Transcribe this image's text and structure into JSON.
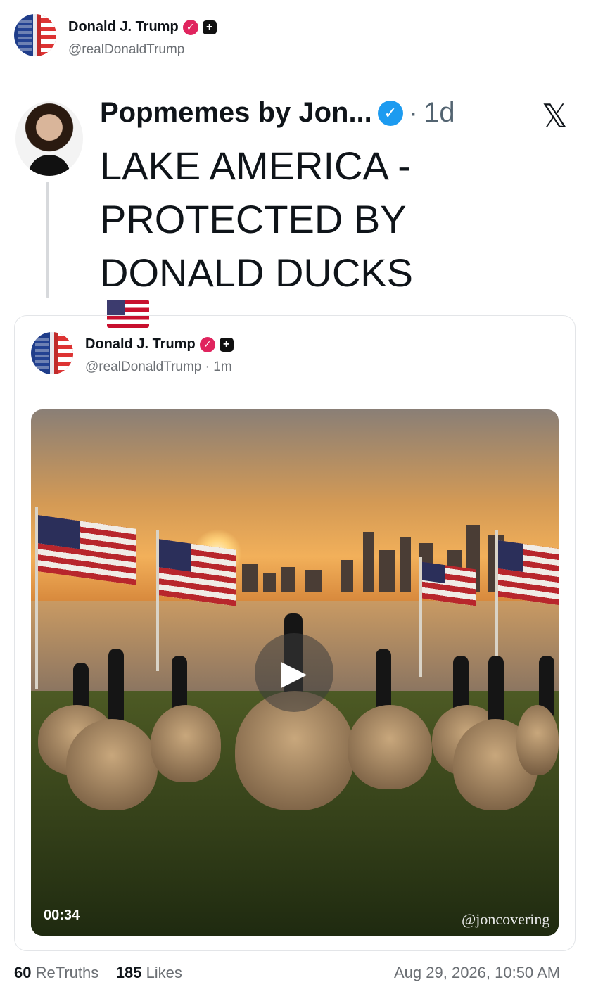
{
  "post": {
    "author_name": "Donald J. Trump",
    "author_handle": "@realDonaldTrump"
  },
  "embedded_x_post": {
    "author_name": "Popmemes by Jon...",
    "separator": "·",
    "age": "1d",
    "text_lines": [
      "LAKE AMERICA -",
      "PROTECTED BY",
      "DONALD DUCKS"
    ],
    "flag_emoji": "🇺🇸",
    "platform_icon": "𝕏"
  },
  "quoted_card": {
    "author_name": "Donald J. Trump",
    "author_handle_time": "@realDonaldTrump · 1m",
    "video": {
      "duration": "00:34",
      "watermark": "@joncovering"
    }
  },
  "footer": {
    "retruths_count": "60",
    "retruths_label": "ReTruths",
    "likes_count": "185",
    "likes_label": "Likes",
    "timestamp": "Aug 29, 2026, 10:50 AM"
  },
  "colors": {
    "verified_pink": "#e0245e",
    "verified_blue": "#1d9bf0",
    "text_primary": "#0f1419",
    "text_secondary": "#6b6f74"
  }
}
